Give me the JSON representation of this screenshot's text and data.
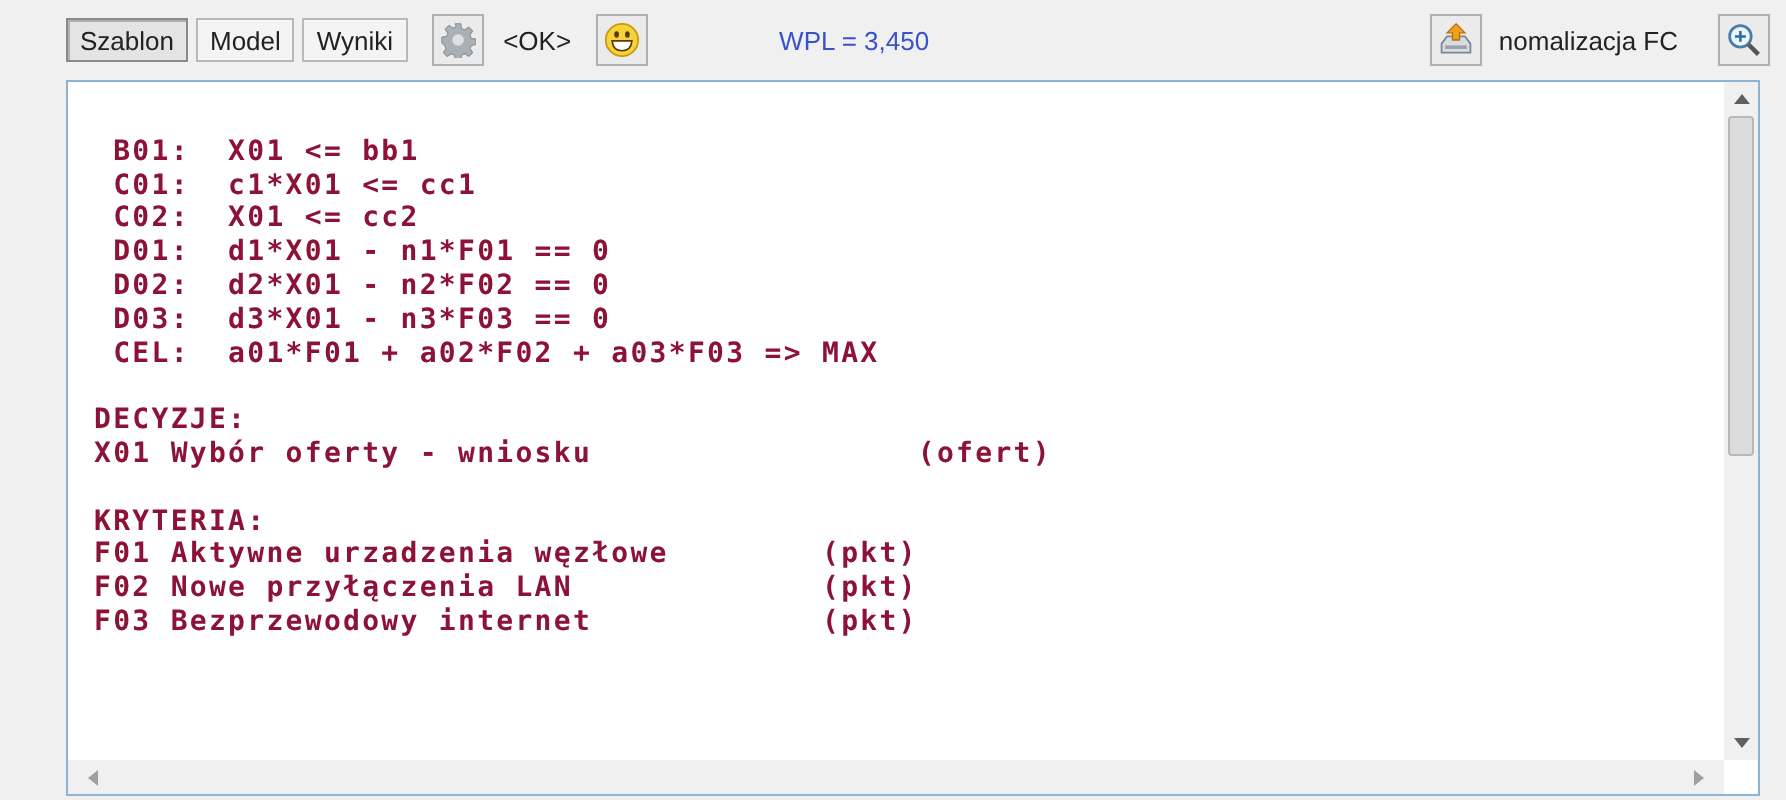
{
  "toolbar": {
    "tabs": [
      {
        "label": "Szablon",
        "selected": true
      },
      {
        "label": "Model",
        "selected": false
      },
      {
        "label": "Wyniki",
        "selected": false
      }
    ],
    "status": "<OK>",
    "wpl": "WPL = 3,450",
    "normalization_label": "nomalizacja FC"
  },
  "editor": {
    "lines": [
      {
        "kind": "blank"
      },
      {
        "kind": "text",
        "text": " B01:  X01 <= bb1"
      },
      {
        "kind": "text",
        "text": " C01:  c1*X01 <= cc1"
      },
      {
        "kind": "text",
        "text": " C02:  X01 <= cc2"
      },
      {
        "kind": "text",
        "text": " D01:  d1*X01 - n1*F01 == 0"
      },
      {
        "kind": "text",
        "text": " D02:  d2*X01 - n2*F02 == 0"
      },
      {
        "kind": "text",
        "text": " D03:  d3*X01 - n3*F03 == 0"
      },
      {
        "kind": "text",
        "text": " CEL:  a01*F01 + a02*F02 + a03*F03 => MAX"
      },
      {
        "kind": "blank"
      },
      {
        "kind": "text",
        "text": "DECYZJE:"
      },
      {
        "kind": "text",
        "text": "X01 Wybór oferty - wniosku                 (ofert)"
      },
      {
        "kind": "blank"
      },
      {
        "kind": "text",
        "text": "KRYTERIA:"
      },
      {
        "kind": "text",
        "text": "F01 Aktywne urzadzenia węzłowe        (pkt)"
      },
      {
        "kind": "text",
        "text": "F02 Nowe przyłączenia LAN             (pkt)"
      },
      {
        "kind": "text",
        "text": "F03 Bezprzewodowy internet            (pkt)"
      }
    ]
  }
}
